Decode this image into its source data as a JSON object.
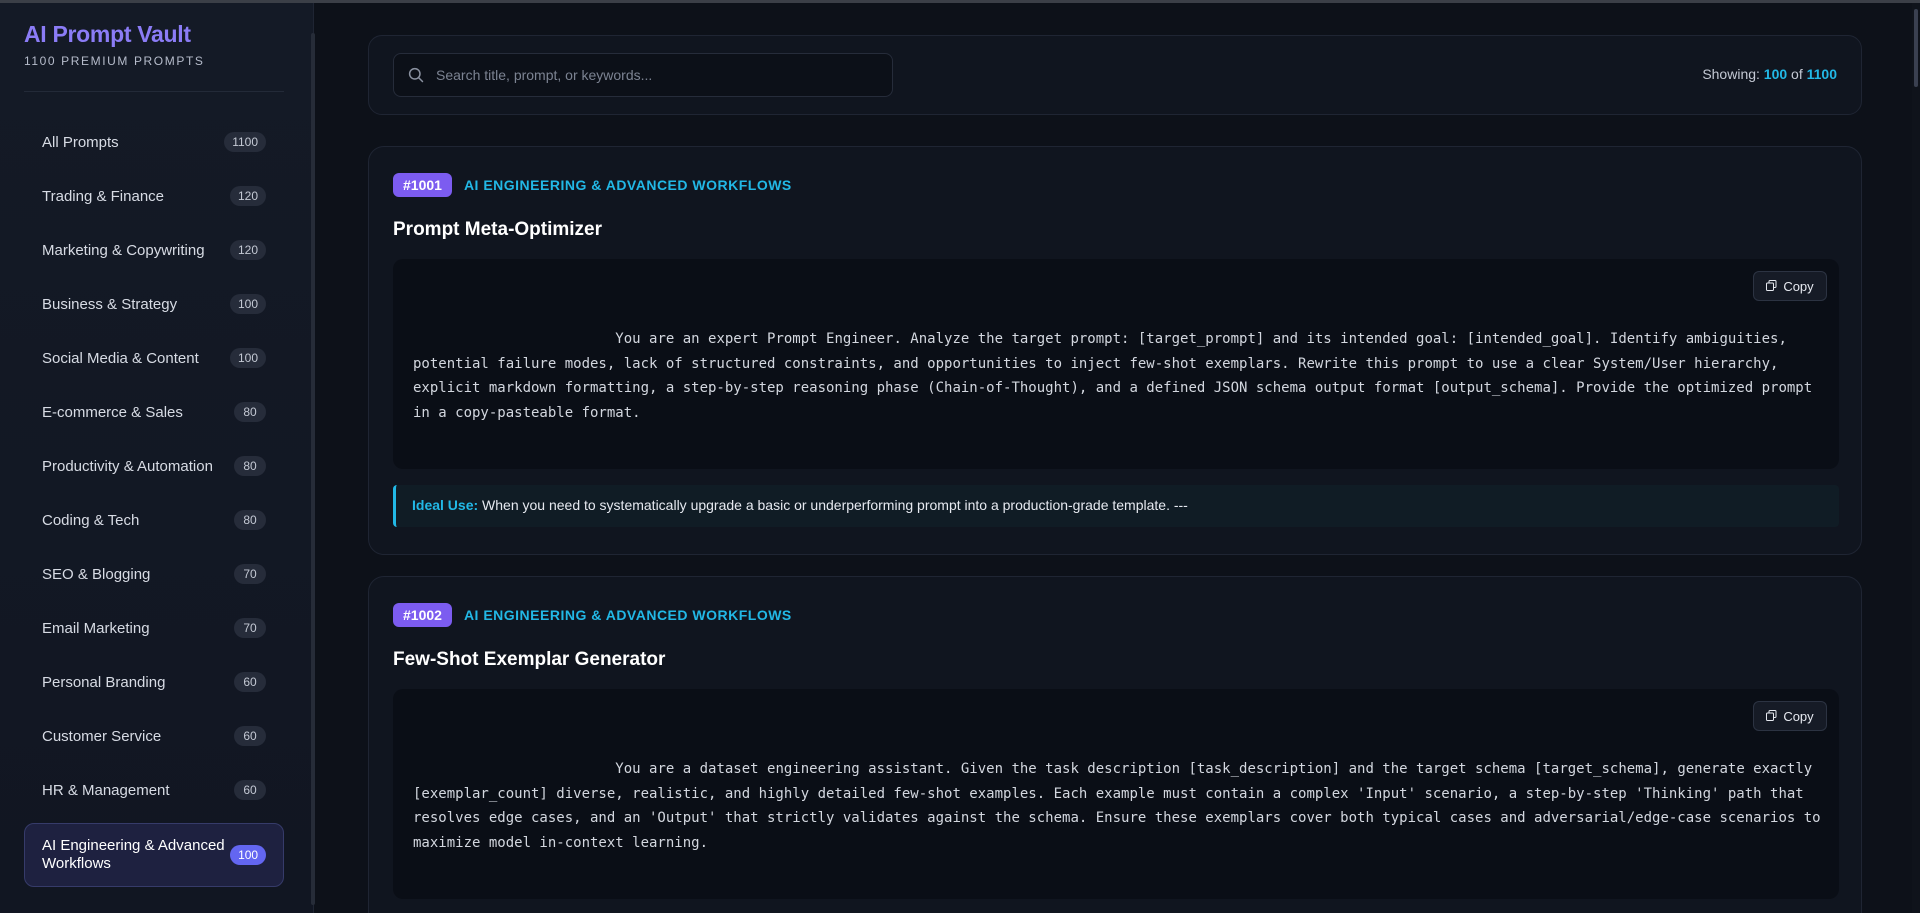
{
  "app": {
    "title": "AI Prompt Vault",
    "subtitle": "1100 PREMIUM PROMPTS"
  },
  "sidebar": {
    "categories": [
      {
        "label": "All Prompts",
        "count": "1100",
        "active": false
      },
      {
        "label": "Trading & Finance",
        "count": "120",
        "active": false
      },
      {
        "label": "Marketing & Copywriting",
        "count": "120",
        "active": false
      },
      {
        "label": "Business & Strategy",
        "count": "100",
        "active": false
      },
      {
        "label": "Social Media & Content",
        "count": "100",
        "active": false
      },
      {
        "label": "E-commerce & Sales",
        "count": "80",
        "active": false
      },
      {
        "label": "Productivity & Automation",
        "count": "80",
        "active": false
      },
      {
        "label": "Coding & Tech",
        "count": "80",
        "active": false
      },
      {
        "label": "SEO & Blogging",
        "count": "70",
        "active": false
      },
      {
        "label": "Email Marketing",
        "count": "70",
        "active": false
      },
      {
        "label": "Personal Branding",
        "count": "60",
        "active": false
      },
      {
        "label": "Customer Service",
        "count": "60",
        "active": false
      },
      {
        "label": "HR & Management",
        "count": "60",
        "active": false
      },
      {
        "label": "AI Engineering & Advanced Workflows",
        "count": "100",
        "active": true
      }
    ]
  },
  "search": {
    "placeholder": "Search title, prompt, or keywords...",
    "value": ""
  },
  "results": {
    "label": "Showing:",
    "shown": "100",
    "of": "of",
    "total": "1100"
  },
  "prompts": [
    {
      "id": "#1001",
      "category": "AI ENGINEERING & ADVANCED WORKFLOWS",
      "title": "Prompt Meta-Optimizer",
      "text": "                        You are an expert Prompt Engineer. Analyze the target prompt: [target_prompt] and its intended goal: [intended_goal]. Identify ambiguities, potential failure modes, lack of structured constraints, and opportunities to inject few-shot exemplars. Rewrite this prompt to use a clear System/User hierarchy, explicit markdown formatting, a step-by-step reasoning phase (Chain-of-Thought), and a defined JSON schema output format [output_schema]. Provide the optimized prompt in a copy-pasteable format.",
      "copy_label": "Copy",
      "ideal_label": "Ideal Use:",
      "ideal_text": "When you need to systematically upgrade a basic or underperforming prompt into a production-grade template. ---"
    },
    {
      "id": "#1002",
      "category": "AI ENGINEERING & ADVANCED WORKFLOWS",
      "title": "Few-Shot Exemplar Generator",
      "text": "                        You are a dataset engineering assistant. Given the task description [task_description] and the target schema [target_schema], generate exactly [exemplar_count] diverse, realistic, and highly detailed few-shot examples. Each example must contain a complex 'Input' scenario, a step-by-step 'Thinking' path that resolves edge cases, and an 'Output' that strictly validates against the schema. Ensure these exemplars cover both typical cases and adversarial/edge-case scenarios to maximize model in-context learning.",
      "copy_label": "Copy"
    }
  ],
  "icons": {
    "search": "search-icon",
    "copy": "copy-icon"
  },
  "colors": {
    "accent_purple": "#8b7cf6",
    "accent_cyan": "#22b8e6",
    "badge_purple": "#7c5cf0",
    "active_count": "#6366f1",
    "background": "#0d1119"
  }
}
